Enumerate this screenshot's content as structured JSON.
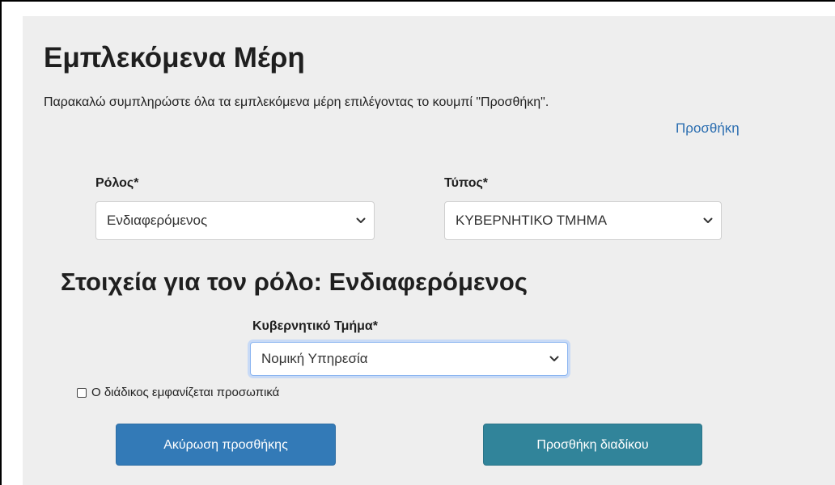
{
  "header": {
    "title": "Εμπλεκόμενα Μέρη",
    "instructions": "Παρακαλώ συμπληρώστε όλα τα εμπλεκόμενα μέρη επιλέγοντας το κουμπί \"Προσθήκη\".",
    "add_link": "Προσθήκη"
  },
  "form": {
    "role": {
      "label": "Ρόλος*",
      "selected": "Ενδιαφερόμενος"
    },
    "type": {
      "label": "Τύπος*",
      "selected": "ΚΥΒΕΡΝΗΤΙΚΟ ΤΜΗΜΑ"
    }
  },
  "details": {
    "heading": "Στοιχεία για τον ρόλο: Ενδιαφερόμενος",
    "department": {
      "label": "Κυβερνητικό Τμήμα*",
      "selected": "Νομική Υπηρεσία"
    },
    "appears_in_person": {
      "label": "Ο διάδικος εμφανίζεται προσωπικά",
      "checked": false
    }
  },
  "actions": {
    "cancel_label": "Ακύρωση προσθήκης",
    "add_label": "Προσθήκη διαδίκου"
  },
  "colors": {
    "panel_background": "#eeeeee",
    "link": "#2a6db0",
    "cancel_button": "#337ab7",
    "add_button": "#31849a",
    "focus_ring": "#c8daf6"
  }
}
